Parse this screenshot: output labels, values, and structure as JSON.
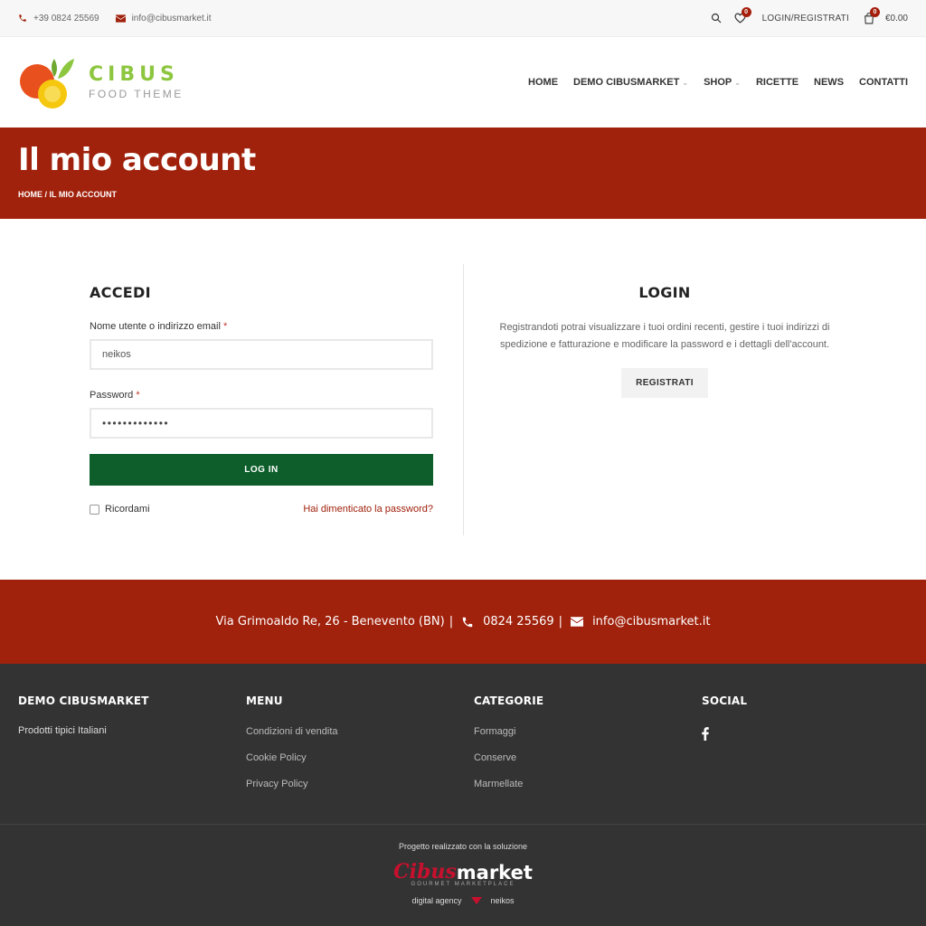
{
  "topbar": {
    "phone": "+39 0824 25569",
    "email": "info@cibusmarket.it",
    "wishlist_count": "0",
    "login_label": "LOGIN/REGISTRATI",
    "cart_count": "0",
    "cart_total": "€0.00"
  },
  "header": {
    "logo_title": "CIBUS",
    "logo_sub": "FOOD THEME",
    "nav": [
      {
        "label": "HOME"
      },
      {
        "label": "DEMO CIBUSMARKET"
      },
      {
        "label": "SHOP"
      },
      {
        "label": "RICETTE"
      },
      {
        "label": "NEWS"
      },
      {
        "label": "CONTATTI"
      }
    ]
  },
  "hero": {
    "title": "Il mio account",
    "breadcrumb": "HOME / IL MIO ACCOUNT"
  },
  "login": {
    "title": "ACCEDI",
    "username_label": "Nome utente o indirizzo email",
    "username_value": "neikos",
    "password_label": "Password",
    "password_value": "•••••••••••••",
    "required_mark": "*",
    "button": "LOG IN",
    "remember": "Ricordami",
    "forgot": "Hai dimenticato la password?"
  },
  "register": {
    "title": "LOGIN",
    "text": "Registrandoti potrai visualizzare i tuoi ordini recenti, gestire i tuoi indirizzi di spedizione e fatturazione e modificare la password e i dettagli dell'account.",
    "button": "REGISTRATI"
  },
  "address_bar": {
    "address": "Via Grimoaldo Re, 26 - Benevento (BN)",
    "separator": "|",
    "phone": "0824 25569",
    "email": "info@cibusmarket.it"
  },
  "footer": {
    "col1": {
      "title": "DEMO CIBUSMARKET",
      "text": "Prodotti tipici Italiani"
    },
    "col2": {
      "title": "MENU",
      "links": [
        "Condizioni di vendita",
        "Cookie Policy",
        "Privacy Policy"
      ]
    },
    "col3": {
      "title": "CATEGORIE",
      "links": [
        "Formaggi",
        "Conserve",
        "Marmellate"
      ]
    },
    "col4": {
      "title": "SOCIAL"
    }
  },
  "bottom": {
    "project_text": "Progetto realizzato con la soluzione",
    "logo_cibus": "Cibus",
    "logo_market": "market",
    "logo_sub": "GOURMET MARKETPLACE",
    "agency_label": "digital agency",
    "agency_name": "neikos"
  },
  "colors": {
    "brand_red": "#a0210c",
    "login_green": "#0d5e2a",
    "logo_green": "#8dc63f",
    "footer_bg": "#333333"
  }
}
